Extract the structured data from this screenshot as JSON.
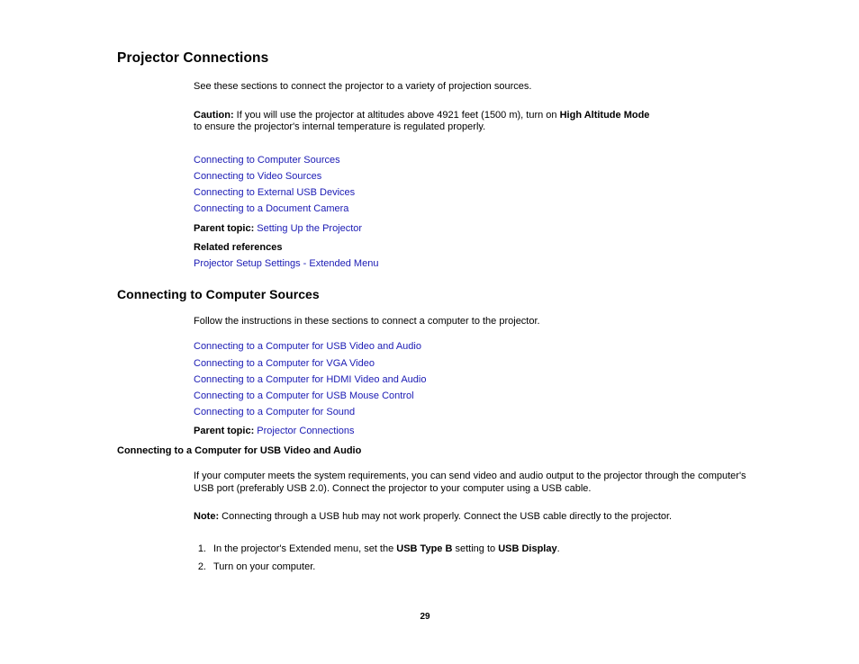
{
  "document": {
    "title": "Projector Connections",
    "intro": "See these sections to connect the projector to a variety of projection sources.",
    "caution_label": "Caution:",
    "caution_text_1": " If you will use the projector at altitudes above 4921 feet (1500 m), turn on ",
    "caution_bold": "High Altitude Mode",
    "caution_text_2": "to ensure the projector's internal temperature is regulated properly.",
    "links": [
      "Connecting to Computer Sources",
      "Connecting to Video Sources",
      "Connecting to External USB Devices",
      "Connecting to a Document Camera"
    ],
    "parent_topic_label": "Parent topic:",
    "parent_topic_link": "Setting Up the Projector",
    "related_references_label": "Related references",
    "related_reference_link": "Projector Setup Settings - Extended Menu",
    "section": {
      "heading": "Connecting to Computer Sources",
      "intro": "Follow the instructions in these sections to connect a computer to the projector.",
      "links": [
        "Connecting to a Computer for USB Video and Audio",
        "Connecting to a Computer for VGA Video",
        "Connecting to a Computer for HDMI Video and Audio",
        "Connecting to a Computer for USB Mouse Control",
        "Connecting to a Computer for Sound"
      ],
      "parent_topic_label": "Parent topic:",
      "parent_topic_link": "Projector Connections"
    },
    "subsection": {
      "heading": "Connecting to a Computer for USB Video and Audio",
      "paragraph": "If your computer meets the system requirements, you can send video and audio output to the projector through the computer's USB port (preferably USB 2.0). Connect the projector to your computer using a USB cable.",
      "note_label": "Note:",
      "note_text": " Connecting through a USB hub may not work properly. Connect the USB cable directly to the projector.",
      "steps": [
        {
          "number": "1.",
          "text_1": "In the projector's Extended menu, set the ",
          "bold_1": "USB Type B",
          "text_2": " setting to ",
          "bold_2": "USB Display",
          "text_3": "."
        },
        {
          "number": "2.",
          "text_1": "Turn on your computer.",
          "bold_1": "",
          "text_2": "",
          "bold_2": "",
          "text_3": ""
        }
      ]
    },
    "page_number": "29"
  },
  "colors": {
    "link": "#1a1ab4",
    "text": "#000000",
    "background": "#ffffff"
  }
}
